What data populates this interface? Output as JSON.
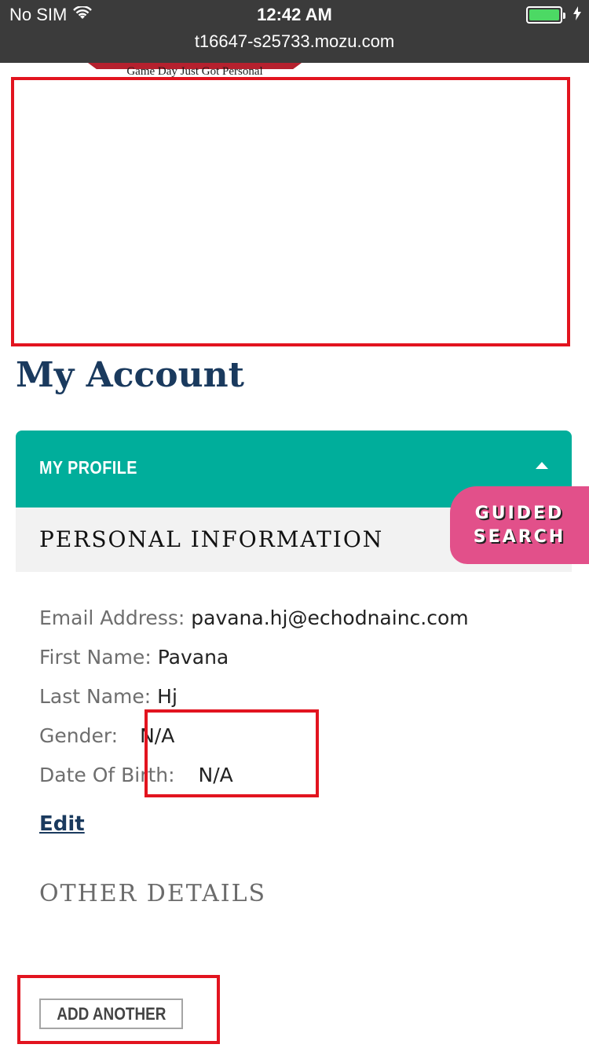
{
  "status_bar": {
    "carrier": "No SIM",
    "time": "12:42 AM",
    "url": "t16647-s25733.mozu.com",
    "battery_color": "#4cd964",
    "battery_level": 1.0
  },
  "header": {
    "tagline": "Game Day Just Got Personal"
  },
  "page": {
    "title": "My Account"
  },
  "profile_accordion": {
    "label": "MY PROFILE",
    "color": "#00ae9b",
    "expanded": true
  },
  "personal_information": {
    "title": "PERSONAL INFORMATION",
    "fields": [
      {
        "label": "Email Address:",
        "value": "pavana.hj@echodnainc.com"
      },
      {
        "label": "First Name:",
        "value": "Pavana"
      },
      {
        "label": "Last Name:",
        "value": "Hj"
      },
      {
        "label": "Gender:",
        "value": "N/A"
      },
      {
        "label": "Date Of Birth:",
        "value": "N/A"
      }
    ],
    "edit_label": "Edit"
  },
  "guided_search": {
    "line1": "GUIDED",
    "line2": "SEARCH",
    "color": "#e2508a"
  },
  "other_details": {
    "title": "OTHER DETAILS",
    "add_label": "ADD ANOTHER"
  },
  "annotation_color": "#e2141f"
}
